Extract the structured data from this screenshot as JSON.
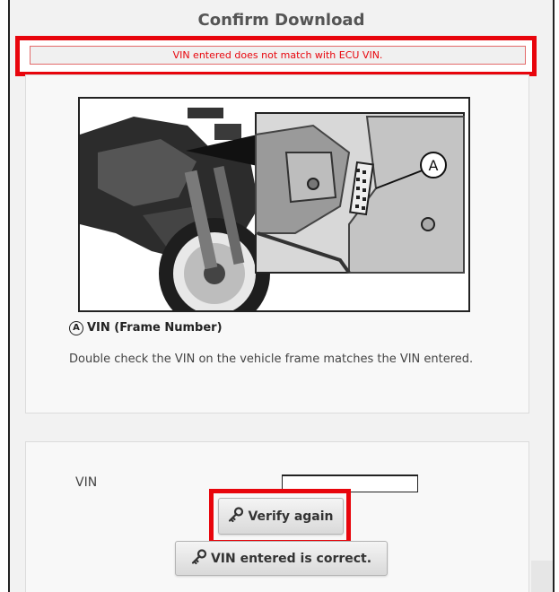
{
  "dialog": {
    "title": "Confirm Download",
    "error_message": "VIN entered does not match with ECU VIN."
  },
  "figure": {
    "callout_letter": "A",
    "caption_marker": "A",
    "caption_text": "VIN (Frame Number)"
  },
  "instruction": "Double check the VIN on the vehicle frame matches the VIN entered.",
  "form": {
    "vin_label": "VIN",
    "vin_value": "",
    "verify_button": "Verify again",
    "correct_button": "VIN entered is correct."
  },
  "icons": {
    "verify_icon": "key-icon",
    "correct_icon": "key-icon"
  },
  "colors": {
    "highlight_red": "#e8050c",
    "background": "#f2f2f2"
  }
}
